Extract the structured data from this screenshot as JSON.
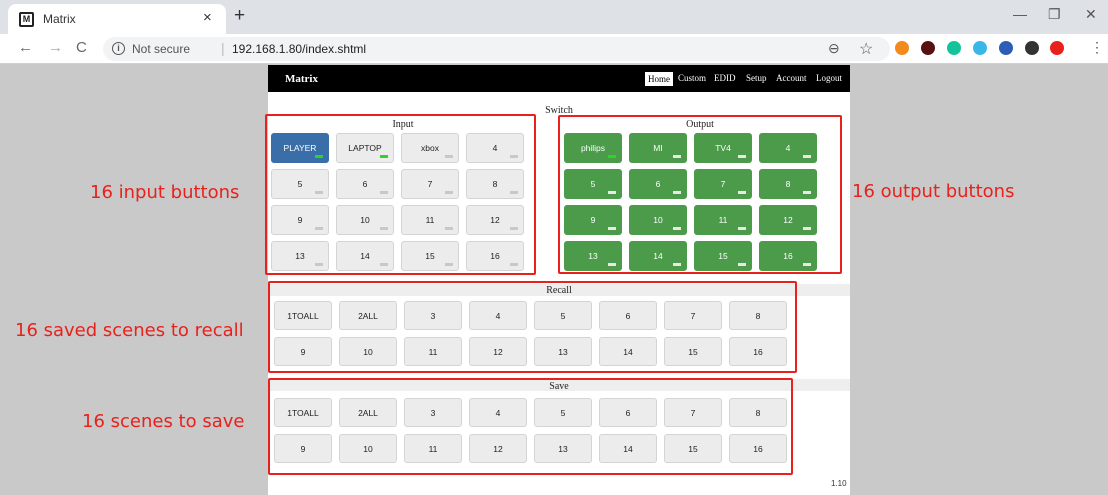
{
  "browser": {
    "tab_title": "Matrix",
    "favicon_letter": "M",
    "tab_close": "×",
    "new_tab": "+",
    "back": "←",
    "forward": "→",
    "reload": "C",
    "security_text": "Not secure",
    "separator": "|",
    "url": "192.168.1.80/index.shtml",
    "zoom_icon": "⊖",
    "star_icon": "☆",
    "minimize": "—",
    "restore": "❐",
    "close": "✕",
    "menu": "⋮"
  },
  "nav": {
    "brand": "Matrix",
    "links": [
      "Home",
      "Custom",
      "EDID",
      "Setup",
      "Account",
      "Logout"
    ]
  },
  "switch_section": {
    "title": "Switch",
    "input_title": "Input",
    "output_title": "Output",
    "inputs": [
      "PLAYER",
      "LAPTOP",
      "xbox",
      "4",
      "5",
      "6",
      "7",
      "8",
      "9",
      "10",
      "11",
      "12",
      "13",
      "14",
      "15",
      "16"
    ],
    "outputs": [
      "philips",
      "MI",
      "TV4",
      "4",
      "5",
      "6",
      "7",
      "8",
      "9",
      "10",
      "11",
      "12",
      "13",
      "14",
      "15",
      "16"
    ],
    "selected_input": 0,
    "input_leds_on": [
      0,
      1
    ],
    "output_leds_on": [
      0
    ]
  },
  "recall_section": {
    "title": "Recall",
    "scenes": [
      "1TOALL",
      "2ALL",
      "3",
      "4",
      "5",
      "6",
      "7",
      "8",
      "9",
      "10",
      "11",
      "12",
      "13",
      "14",
      "15",
      "16"
    ]
  },
  "save_section": {
    "title": "Save",
    "scenes": [
      "1TOALL",
      "2ALL",
      "3",
      "4",
      "5",
      "6",
      "7",
      "8",
      "9",
      "10",
      "11",
      "12",
      "13",
      "14",
      "15",
      "16"
    ]
  },
  "version": "1.10",
  "annotations": {
    "input": "16 input buttons",
    "output": "16 output buttons",
    "recall": "16 saved scenes to recall",
    "save": "16 scenes to save"
  },
  "colors": {
    "annotation": "#e8211c",
    "selected_input": "#3a6ea8",
    "output_button": "#4b9b4b",
    "led_on": "#27d627"
  }
}
